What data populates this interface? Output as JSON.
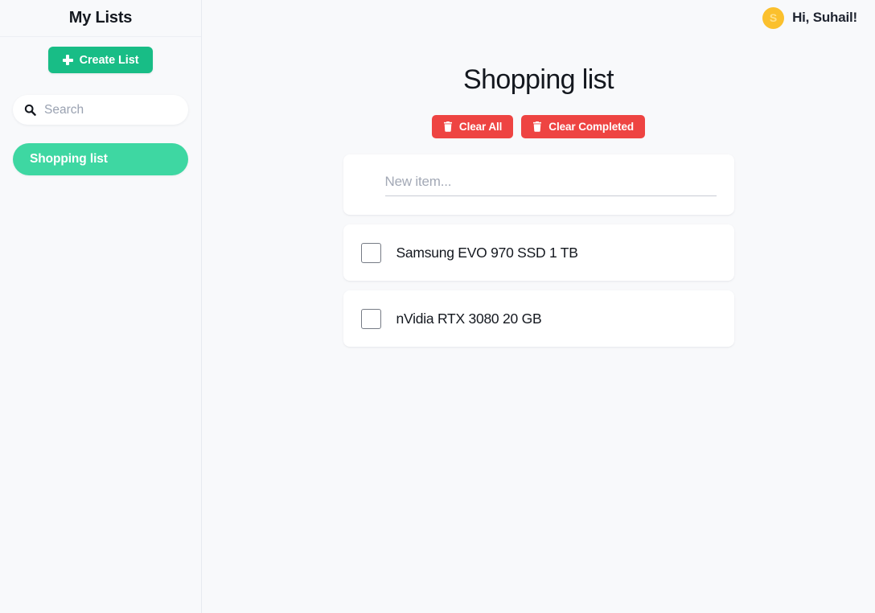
{
  "theme": {
    "page_bg": "#f8f9fb",
    "card_bg": "#ffffff",
    "accent_green": "#18bd86",
    "pill_green": "#3ed7a2",
    "danger_red": "#ee4442",
    "avatar_yellow": "#fbc02d",
    "text_dark": "#14181f",
    "placeholder_gray": "#9aa2b1"
  },
  "sidebar": {
    "title": "My Lists",
    "create_button": {
      "label": "Create List",
      "icon": "plus-icon"
    },
    "search": {
      "value": "",
      "placeholder": "Search",
      "icon": "search-icon"
    },
    "lists": [
      {
        "label": "Shopping list",
        "selected": true
      }
    ]
  },
  "topbar": {
    "avatar_initial": "S",
    "greeting": "Hi, Suhail!"
  },
  "main": {
    "title": "Shopping list",
    "actions": [
      {
        "label": "Clear All",
        "icon": "trash-icon",
        "style": "danger"
      },
      {
        "label": "Clear Completed",
        "icon": "trash-icon",
        "style": "danger"
      }
    ],
    "new_item": {
      "value": "",
      "placeholder": "New item..."
    },
    "items": [
      {
        "label": "Samsung EVO 970 SSD 1 TB",
        "completed": false
      },
      {
        "label": "nVidia RTX 3080 20 GB",
        "completed": false
      }
    ]
  }
}
